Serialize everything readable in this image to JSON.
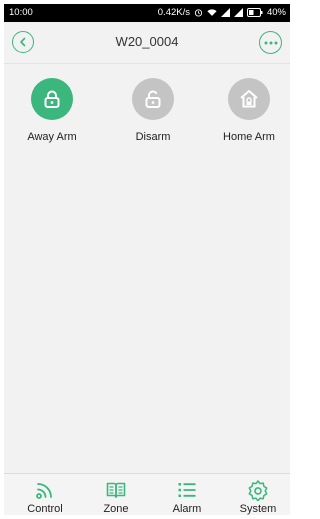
{
  "statusbar": {
    "time": "10:00",
    "speed": "0.42K/s",
    "battery": "40%"
  },
  "header": {
    "title": "W20_0004",
    "back_icon": "chevron-left-icon",
    "more_icon": "more-dots-icon"
  },
  "colors": {
    "accent": "#3bb67c",
    "inactive": "#c4c4c4"
  },
  "modes": [
    {
      "label": "Away Arm",
      "icon": "lock-closed-icon",
      "active": true
    },
    {
      "label": "Disarm",
      "icon": "lock-open-icon",
      "active": false
    },
    {
      "label": "Home Arm",
      "icon": "home-lock-icon",
      "active": false
    }
  ],
  "tabs": [
    {
      "label": "Control",
      "icon": "signal-icon"
    },
    {
      "label": "Zone",
      "icon": "book-icon"
    },
    {
      "label": "Alarm",
      "icon": "list-icon"
    },
    {
      "label": "System",
      "icon": "gear-icon"
    }
  ]
}
